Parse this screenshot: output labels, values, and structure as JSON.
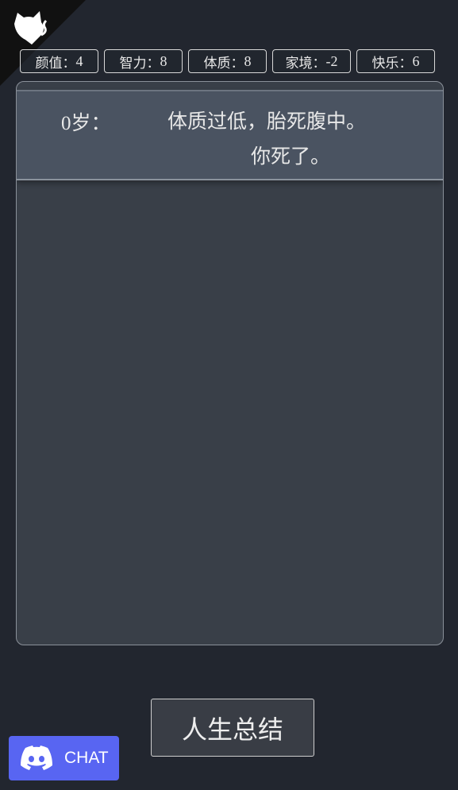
{
  "stats": [
    {
      "label": "颜值：",
      "value": "4"
    },
    {
      "label": "智力：",
      "value": "8"
    },
    {
      "label": "体质：",
      "value": "8"
    },
    {
      "label": "家境：",
      "value": "-2"
    },
    {
      "label": "快乐：",
      "value": "6"
    }
  ],
  "events": [
    {
      "age": "0",
      "age_suffix": "岁：",
      "lines": [
        "体质过低，胎死腹中。",
        "你死了。"
      ]
    }
  ],
  "summary_button": "人生总结",
  "chat_button": {
    "label": "CHAT",
    "icon": "discord-icon",
    "color": "#5865f2"
  },
  "corner_icon": "github-octocat-icon"
}
